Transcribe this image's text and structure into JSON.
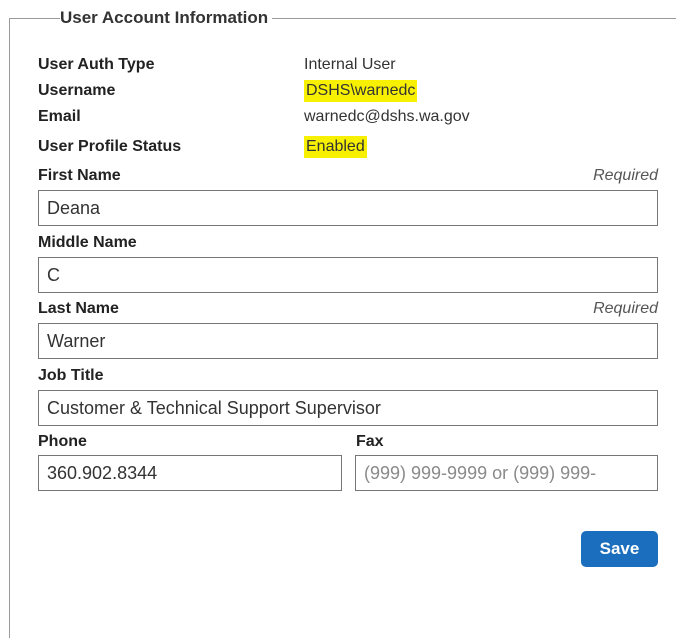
{
  "section_title": "User Account Information",
  "account_info": [
    {
      "label": "User Auth Type",
      "value": "Internal User",
      "highlight": false
    },
    {
      "label": "Username",
      "value": "DSHS\\warnedc",
      "highlight": true
    },
    {
      "label": "Email",
      "value": "warnedc@dshs.wa.gov",
      "highlight": false
    },
    {
      "label": "User Profile Status",
      "value": "Enabled",
      "highlight": true
    }
  ],
  "required_text": "Required",
  "fields": {
    "first_name": {
      "label": "First Name",
      "value": "Deana"
    },
    "middle_name": {
      "label": "Middle Name",
      "value": "C"
    },
    "last_name": {
      "label": "Last Name",
      "value": "Warner"
    },
    "job_title": {
      "label": "Job Title",
      "value": "Customer & Technical Support Supervisor"
    },
    "phone": {
      "label": "Phone",
      "value": "360.902.8344"
    },
    "fax": {
      "label": "Fax",
      "value": "",
      "placeholder": "(999) 999-9999 or (999) 999-"
    }
  },
  "save_label": "Save",
  "highlight_color": "#f7f000",
  "button_color": "#1a6ebd"
}
